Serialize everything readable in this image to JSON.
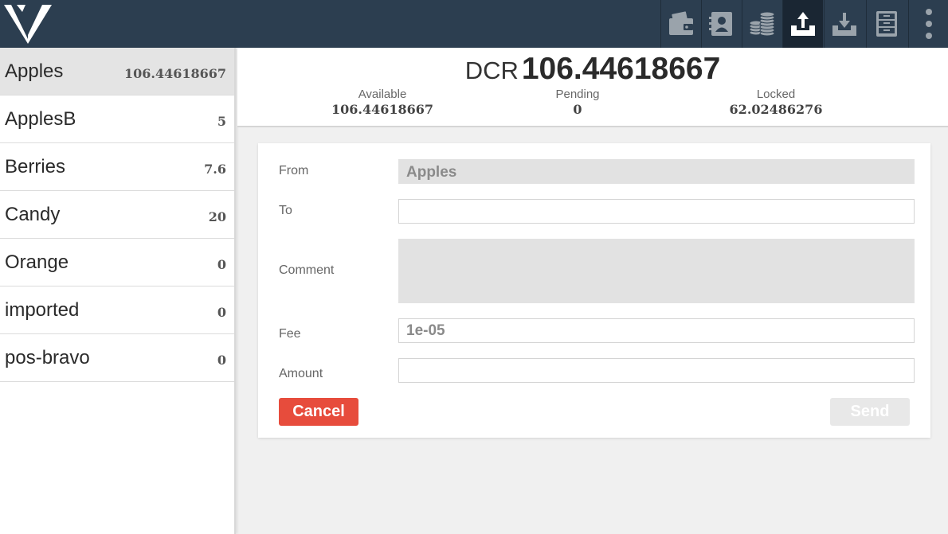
{
  "colors": {
    "topbar": "#2c3e50",
    "topbar_active": "#1a2633",
    "icon": "#9aa3ab",
    "icon_active": "#ffffff",
    "cancel": "#e74c3c",
    "send_disabled": "#e8e8e8"
  },
  "toolbar": {
    "buttons": [
      {
        "icon": "wallet-icon",
        "active": false
      },
      {
        "icon": "address-book-icon",
        "active": false
      },
      {
        "icon": "coins-icon",
        "active": false
      },
      {
        "icon": "send-upload-icon",
        "active": true
      },
      {
        "icon": "receive-download-icon",
        "active": false
      },
      {
        "icon": "cabinet-icon",
        "active": false
      },
      {
        "icon": "more-vertical-icon",
        "active": false
      }
    ]
  },
  "sidebar": {
    "accounts": [
      {
        "name": "Apples",
        "balance": "106.44618667",
        "selected": true
      },
      {
        "name": "ApplesB",
        "balance": "5",
        "selected": false
      },
      {
        "name": "Berries",
        "balance": "7.6",
        "selected": false
      },
      {
        "name": "Candy",
        "balance": "20",
        "selected": false
      },
      {
        "name": "Orange",
        "balance": "0",
        "selected": false
      },
      {
        "name": "imported",
        "balance": "0",
        "selected": false
      },
      {
        "name": "pos-bravo",
        "balance": "0",
        "selected": false
      }
    ]
  },
  "balance": {
    "currency": "DCR",
    "total": "106.44618667",
    "available_label": "Available",
    "available": "106.44618667",
    "pending_label": "Pending",
    "pending": "0",
    "locked_label": "Locked",
    "locked": "62.02486276"
  },
  "form": {
    "from_label": "From",
    "from_value": "Apples",
    "to_label": "To",
    "to_value": "",
    "comment_label": "Comment",
    "comment_value": "",
    "fee_label": "Fee",
    "fee_value": "1e-05",
    "amount_label": "Amount",
    "amount_value": "",
    "cancel_label": "Cancel",
    "send_label": "Send"
  }
}
